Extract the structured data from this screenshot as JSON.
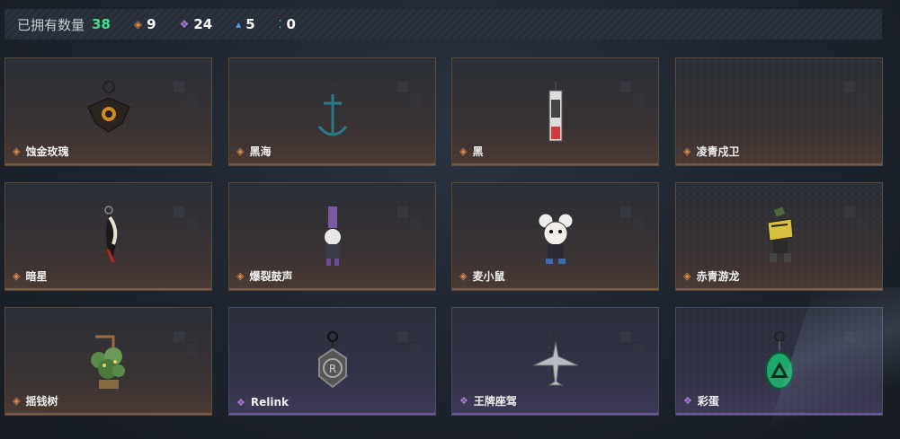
{
  "header": {
    "owned_label": "已拥有数量",
    "owned_count": "38",
    "stats": [
      {
        "icon": "orange-diamond-icon",
        "value": "9"
      },
      {
        "icon": "purple-diamond-icon",
        "value": "24"
      },
      {
        "icon": "blue-chevron-icon",
        "value": "5"
      },
      {
        "icon": "green-dots-icon",
        "value": "0"
      }
    ]
  },
  "colors": {
    "owned_count": "#3ee08a",
    "orange_rarity": "#e08a4a",
    "purple_rarity": "#a57de0",
    "blue_rarity": "#4d9fe6",
    "green_rarity": "#3ee0a0"
  },
  "items": [
    {
      "name": "蚀金玫瑰",
      "rarity": "orange",
      "icon": "rose-pendant-icon"
    },
    {
      "name": "黑海",
      "rarity": "orange",
      "icon": "anchor-pendant-icon"
    },
    {
      "name": "黑",
      "rarity": "orange",
      "icon": "tag-pendant-icon"
    },
    {
      "name": "凌青戍卫",
      "rarity": "orange",
      "icon": "empty-slot-icon"
    },
    {
      "name": "暗星",
      "rarity": "orange",
      "icon": "feather-pendant-icon"
    },
    {
      "name": "爆裂鼓声",
      "rarity": "orange",
      "icon": "figure-pendant-icon"
    },
    {
      "name": "麦小鼠",
      "rarity": "orange",
      "icon": "mouse-pendant-icon"
    },
    {
      "name": "赤青游龙",
      "rarity": "orange",
      "icon": "dragon-pendant-icon"
    },
    {
      "name": "摇钱树",
      "rarity": "orange",
      "icon": "money-tree-pendant-icon"
    },
    {
      "name": "Relink",
      "rarity": "purple",
      "icon": "relink-pendant-icon"
    },
    {
      "name": "王牌座驾",
      "rarity": "purple",
      "icon": "jet-pendant-icon"
    },
    {
      "name": "彩蛋",
      "rarity": "purple",
      "icon": "triangle-pendant-icon"
    }
  ]
}
